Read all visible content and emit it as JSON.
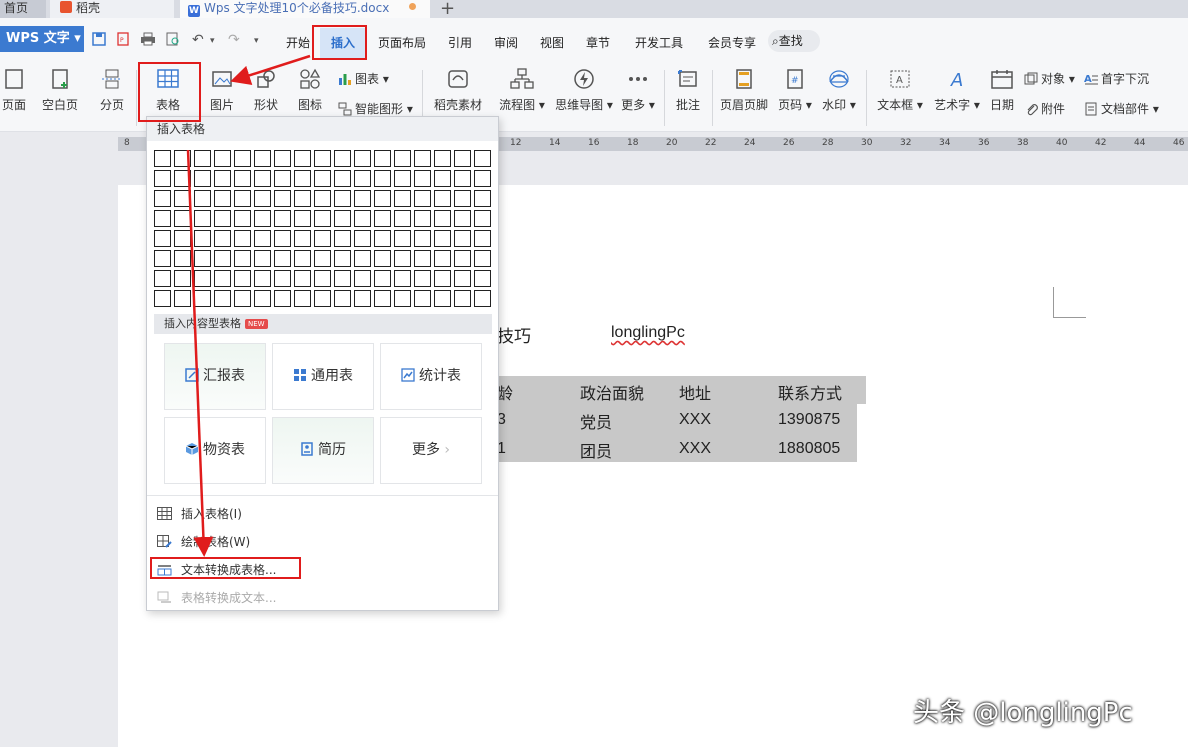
{
  "tabs": {
    "home": "首页",
    "daoke": "稻壳",
    "doc": "Wps 文字处理10个必备技巧.docx",
    "plus": "+"
  },
  "menubar": {
    "app_button": "WPS 文字",
    "items": [
      "开始",
      "插入",
      "页面布局",
      "引用",
      "审阅",
      "视图",
      "章节",
      "开发工具",
      "会员专享"
    ],
    "search": "查找"
  },
  "ribbon": {
    "page": "页面",
    "blank_page": "空白页",
    "page_break": "分页",
    "table": "表格",
    "picture": "图片",
    "shape": "形状",
    "icon": "图标",
    "chart": "图表",
    "smart_art": "智能图形",
    "daoke_material": "稻壳素材",
    "flowchart": "流程图",
    "mindmap": "思维导图",
    "more": "更多",
    "comment": "批注",
    "header_footer": "页眉页脚",
    "page_number": "页码",
    "watermark": "水印",
    "textbox": "文本框",
    "wordart": "艺术字",
    "date": "日期",
    "object": "对象",
    "attachment": "附件",
    "drop_cap": "首字下沉",
    "doc_parts": "文档部件",
    "dropdown_arrow": "▾"
  },
  "ruler": [
    "8",
    "12",
    "14",
    "16",
    "18",
    "20",
    "22",
    "24",
    "26",
    "28",
    "30",
    "32",
    "34",
    "36",
    "38",
    "40",
    "42",
    "44",
    "46"
  ],
  "dropdown": {
    "header": "插入表格",
    "content_table_title": "插入内容型表格",
    "new_badge": "NEW",
    "cards": [
      "汇报表",
      "通用表",
      "统计表",
      "物资表",
      "简历",
      "更多"
    ],
    "more_chevron": "›",
    "menu": [
      "插入表格(I)",
      "绘制表格(W)",
      "文本转换成表格...",
      "表格转换成文本..."
    ]
  },
  "document": {
    "title_fragment": "技巧",
    "author": "longlingPc",
    "table": {
      "header": [
        "龄",
        "政治面貌",
        "地址",
        "联系方式"
      ],
      "rows": [
        [
          "3",
          "党员",
          "XXX",
          "1390875"
        ],
        [
          "1",
          "团员",
          "XXX",
          "1880805"
        ]
      ]
    }
  },
  "watermark": "头条 @longlingPc",
  "colors": {
    "accent": "#3b7ad0",
    "annotation_red": "#e01c1c",
    "active_tab_bg": "#d6e4f7"
  }
}
